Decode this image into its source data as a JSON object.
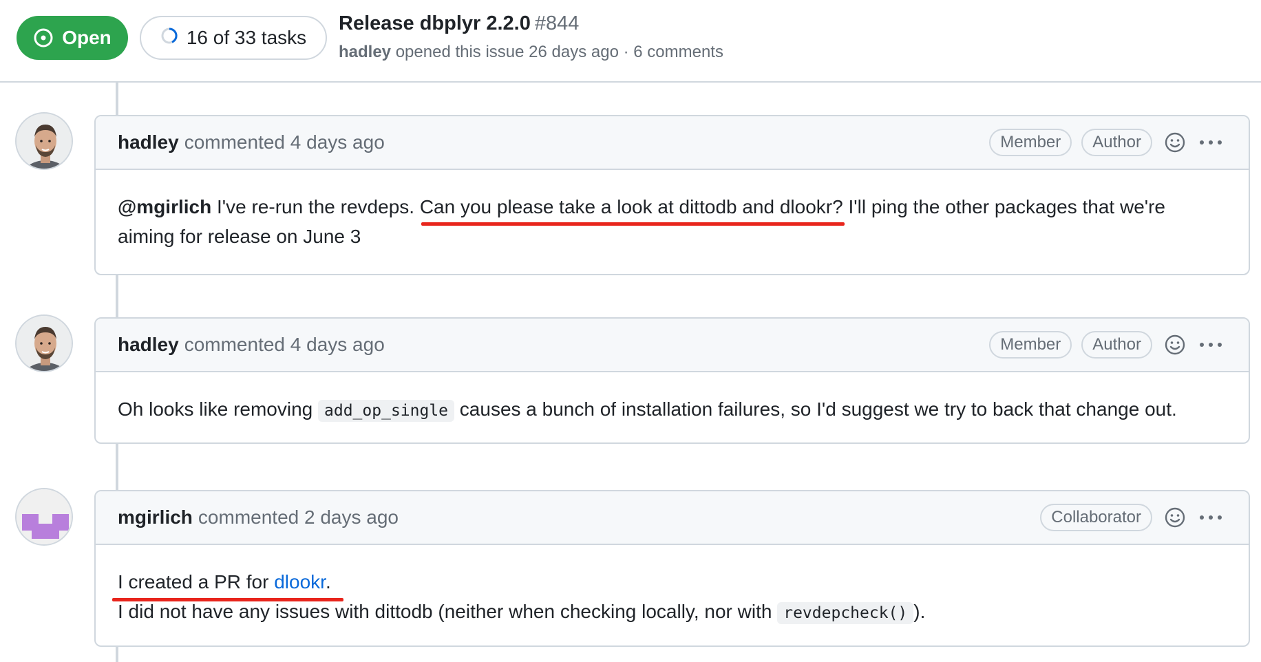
{
  "issue": {
    "state": "Open",
    "tasks": "16 of 33 tasks",
    "title": "Release dbplyr 2.2.0",
    "number": "#844",
    "author": "hadley",
    "meta": "opened this issue 26 days ago · 6 comments"
  },
  "comments": [
    {
      "author": "hadley",
      "when": "commented 4 days ago",
      "roles": [
        "Member",
        "Author"
      ],
      "mention": "@mgirlich",
      "text1": " I've re-run the revdeps. ",
      "highlight": "Can you please take a look at dittodb and dlookr?",
      "text2": " I'll ping the other packages that we're aiming for release on June 3"
    },
    {
      "author": "hadley",
      "when": "commented 4 days ago",
      "roles": [
        "Member",
        "Author"
      ],
      "text1": "Oh looks like removing ",
      "code": "add_op_single",
      "text2": " causes a bunch of installation failures, so I'd suggest we try to back that change out."
    },
    {
      "author": "mgirlich",
      "when": "commented 2 days ago",
      "roles": [
        "Collaborator"
      ],
      "line1_prefix": "I created a PR for ",
      "line1_link": "dlookr",
      "line1_suffix": ".",
      "line2_prefix": "I did not have any issues with dittodb (neither when checking locally, nor with ",
      "line2_code": "revdepcheck()",
      "line2_suffix": ")."
    }
  ],
  "colors": {
    "open_green": "#2da44e",
    "border": "#d0d7de",
    "muted": "#656d76",
    "link": "#0969da",
    "annotation_red": "#e8251c",
    "identicon_purple": "#b87fdc"
  },
  "icons": {
    "state": "issue-opened-icon",
    "tasks": "progress-circle-icon",
    "reaction": "smiley-icon",
    "menu": "kebab-horizontal-icon"
  }
}
